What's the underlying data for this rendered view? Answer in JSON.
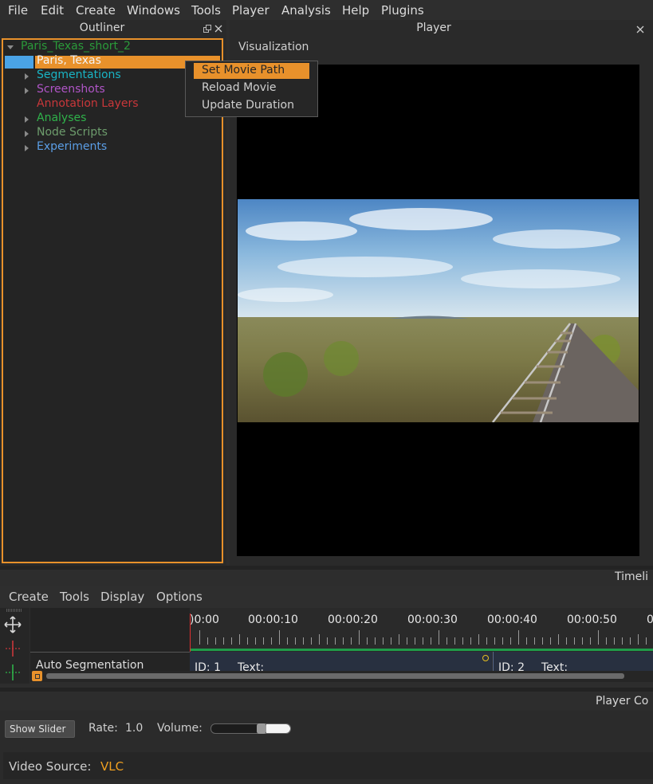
{
  "menubar": [
    "File",
    "Edit",
    "Create",
    "Windows",
    "Tools",
    "Player",
    "Analysis",
    "Help",
    "Plugins"
  ],
  "outliner": {
    "title": "Outliner",
    "root": "Paris_Texas_short_2",
    "selected": "Paris, Texas",
    "items": [
      {
        "label": "Segmentations",
        "color": "#19b4c4",
        "expandable": true
      },
      {
        "label": "Screenshots",
        "color": "#b055c7",
        "expandable": true
      },
      {
        "label": "Annotation Layers",
        "color": "#c9373a",
        "expandable": false
      },
      {
        "label": "Analyses",
        "color": "#2fb24a",
        "expandable": true
      },
      {
        "label": "Node Scripts",
        "color": "#6d9c6c",
        "expandable": true
      },
      {
        "label": "Experiments",
        "color": "#5b9ee6",
        "expandable": true
      }
    ]
  },
  "context_menu": [
    "Set Movie Path",
    "Reload Movie",
    "Update Duration"
  ],
  "player": {
    "title": "Player",
    "tab": "Visualization"
  },
  "timeline": {
    "title": "Timeli",
    "menu": [
      "Create",
      "Tools",
      "Display",
      "Options"
    ],
    "times": [
      ")0:00",
      "00:00:10",
      "00:00:20",
      "00:00:30",
      "00:00:40",
      "00:00:50",
      "0"
    ],
    "track_name": "Auto Segmentation",
    "segments": [
      "ID: 1",
      "Text:",
      "ID: 2",
      "Text:"
    ]
  },
  "player_controls": {
    "title": "Player Co",
    "show_slider": "Show Slider",
    "rate_label": "Rate:",
    "rate_value": "1.0",
    "volume_label": "Volume:",
    "volume_level": 0.64,
    "video_source_label": "Video Source:",
    "video_source_value": "VLC"
  },
  "colors": {
    "accent": "#e8912b",
    "root": "#2a9a3a",
    "video_source": "#f0a020"
  }
}
